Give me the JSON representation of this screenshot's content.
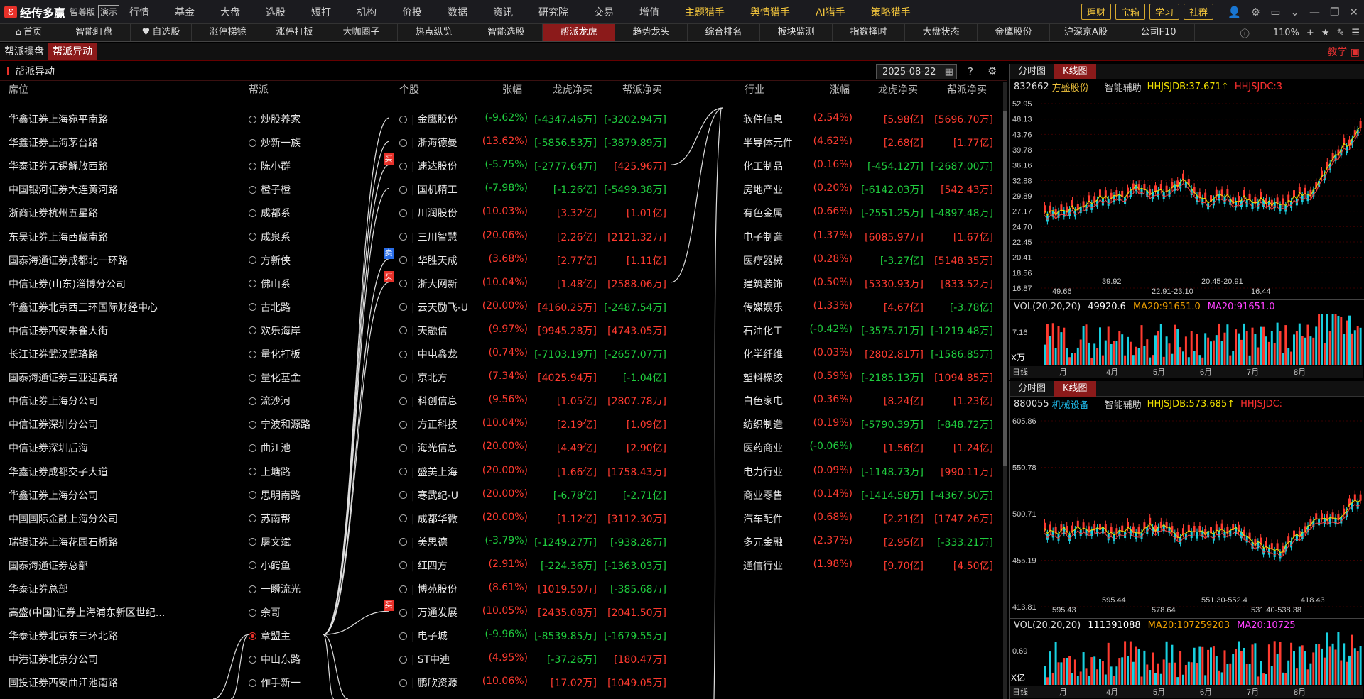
{
  "app": {
    "name": "经传多赢",
    "edition": "智尊版",
    "demo": "演示"
  },
  "menu": [
    "行情",
    "基金",
    "大盘",
    "选股",
    "短打",
    "机构",
    "价投",
    "数据",
    "资讯",
    "研究院",
    "交易",
    "增值"
  ],
  "menu_hl": [
    "主题猎手",
    "舆情猎手",
    "AI猎手",
    "策略猎手"
  ],
  "top_buttons": [
    "理财",
    "宝箱",
    "学习",
    "社群"
  ],
  "tabs": [
    "首页",
    "智能盯盘",
    "自选股",
    "涨停梯镜",
    "涨停打板",
    "大咖圈子",
    "热点纵览",
    "智能选股",
    "帮派龙虎",
    "趋势龙头",
    "综合排名",
    "板块监测",
    "指数择时",
    "大盘状态",
    "金鹰股份",
    "沪深京A股",
    "公司F10"
  ],
  "active_tab": 8,
  "zoom": "110%",
  "subtabs": [
    "帮派操盘",
    "帮派异动"
  ],
  "teach": "教学",
  "panel_title": "帮派异动",
  "date": "2025-08-22",
  "headers": {
    "seat": "席位",
    "gang": "帮派",
    "stock": "个股",
    "pct": "张幅",
    "lh": "龙虎净买",
    "gang_net": "帮派净买",
    "ind": "行业",
    "ind_pct": "涨幅",
    "ind_lh": "龙虎净买",
    "ind_gang": "帮派净买"
  },
  "seats": [
    "华鑫证券上海宛平南路",
    "华鑫证券上海茅台路",
    "华泰证券无锡解放西路",
    "中国银河证券大连黄河路",
    "浙商证券杭州五星路",
    "东吴证券上海西藏南路",
    "国泰海通证券成都北一环路",
    "中信证券(山东)淄博分公司",
    "华鑫证券北京西三环国际财经中心",
    "中信证券西安朱雀大街",
    "长江证券武汉武珞路",
    "国泰海通证券三亚迎宾路",
    "中信证券上海分公司",
    "中信证券深圳分公司",
    "中信证券深圳后海",
    "华鑫证券成都交子大道",
    "华鑫证券上海分公司",
    "中国国际金融上海分公司",
    "瑞银证券上海花园石桥路",
    "国泰海通证券总部",
    "华泰证券总部",
    "高盛(中国)证券上海浦东新区世纪...",
    "华泰证券北京东三环北路",
    "中港证券北京分公司",
    "国投证券西安曲江池南路"
  ],
  "gangs": [
    "炒股养家",
    "炒新一族",
    "陈小群",
    "橙子橙",
    "成都系",
    "成泉系",
    "方新侠",
    "佛山系",
    "古北路",
    "欢乐海岸",
    "量化打板",
    "量化基金",
    "流沙河",
    "宁波和源路",
    "曲江池",
    "上塘路",
    "思明南路",
    "苏南帮",
    "屠文斌",
    "小鳄鱼",
    "一瞬流光",
    "余哥",
    "章盟主",
    "中山东路",
    "作手新一"
  ],
  "active_gang": 22,
  "stocks": [
    {
      "name": "金鹰股份",
      "pct": "(-9.62%)",
      "lh": "[-4347.46万]",
      "gn": "[-3202.94万]",
      "pc": "green",
      "lc": "green",
      "gc": "green"
    },
    {
      "name": "浙海德曼",
      "pct": "(13.62%)",
      "lh": "[-5856.53万]",
      "gn": "[-3879.89万]",
      "pc": "red",
      "lc": "green",
      "gc": "green"
    },
    {
      "name": "速达股份",
      "pct": "(-5.75%)",
      "lh": "[-2777.64万]",
      "gn": "[425.96万]",
      "pc": "green",
      "lc": "green",
      "gc": "red",
      "badge": "买"
    },
    {
      "name": "国机精工",
      "pct": "(-7.98%)",
      "lh": "[-1.26亿]",
      "gn": "[-5499.38万]",
      "pc": "green",
      "lc": "green",
      "gc": "green"
    },
    {
      "name": "川润股份",
      "pct": "(10.03%)",
      "lh": "[3.32亿]",
      "gn": "[1.01亿]",
      "pc": "red",
      "lc": "red",
      "gc": "red"
    },
    {
      "name": "三川智慧",
      "pct": "(20.06%)",
      "lh": "[2.26亿]",
      "gn": "[2121.32万]",
      "pc": "red",
      "lc": "red",
      "gc": "red"
    },
    {
      "name": "华胜天成",
      "pct": "(3.68%)",
      "lh": "[2.77亿]",
      "gn": "[1.11亿]",
      "pc": "red",
      "lc": "red",
      "gc": "red",
      "badge": "卖"
    },
    {
      "name": "浙大网新",
      "pct": "(10.04%)",
      "lh": "[1.48亿]",
      "gn": "[2588.06万]",
      "pc": "red",
      "lc": "red",
      "gc": "red",
      "badge": "买"
    },
    {
      "name": "云天励飞-U",
      "pct": "(20.00%)",
      "lh": "[4160.25万]",
      "gn": "[-2487.54万]",
      "pc": "red",
      "lc": "red",
      "gc": "green"
    },
    {
      "name": "天融信",
      "pct": "(9.97%)",
      "lh": "[9945.28万]",
      "gn": "[4743.05万]",
      "pc": "red",
      "lc": "red",
      "gc": "red"
    },
    {
      "name": "中电鑫龙",
      "pct": "(0.74%)",
      "lh": "[-7103.19万]",
      "gn": "[-2657.07万]",
      "pc": "red",
      "lc": "green",
      "gc": "green"
    },
    {
      "name": "京北方",
      "pct": "(7.34%)",
      "lh": "[4025.94万]",
      "gn": "[-1.04亿]",
      "pc": "red",
      "lc": "red",
      "gc": "green"
    },
    {
      "name": "科创信息",
      "pct": "(9.56%)",
      "lh": "[1.05亿]",
      "gn": "[2807.78万]",
      "pc": "red",
      "lc": "red",
      "gc": "red"
    },
    {
      "name": "方正科技",
      "pct": "(10.04%)",
      "lh": "[2.19亿]",
      "gn": "[1.09亿]",
      "pc": "red",
      "lc": "red",
      "gc": "red"
    },
    {
      "name": "海光信息",
      "pct": "(20.00%)",
      "lh": "[4.49亿]",
      "gn": "[2.90亿]",
      "pc": "red",
      "lc": "red",
      "gc": "red"
    },
    {
      "name": "盛美上海",
      "pct": "(20.00%)",
      "lh": "[1.66亿]",
      "gn": "[1758.43万]",
      "pc": "red",
      "lc": "red",
      "gc": "red"
    },
    {
      "name": "寒武纪-U",
      "pct": "(20.00%)",
      "lh": "[-6.78亿]",
      "gn": "[-2.71亿]",
      "pc": "red",
      "lc": "green",
      "gc": "green"
    },
    {
      "name": "成都华微",
      "pct": "(20.00%)",
      "lh": "[1.12亿]",
      "gn": "[3112.30万]",
      "pc": "red",
      "lc": "red",
      "gc": "red"
    },
    {
      "name": "美思德",
      "pct": "(-3.79%)",
      "lh": "[-1249.27万]",
      "gn": "[-938.28万]",
      "pc": "green",
      "lc": "green",
      "gc": "green"
    },
    {
      "name": "红四方",
      "pct": "(2.91%)",
      "lh": "[-224.36万]",
      "gn": "[-1363.03万]",
      "pc": "red",
      "lc": "green",
      "gc": "green"
    },
    {
      "name": "博苑股份",
      "pct": "(8.61%)",
      "lh": "[1019.50万]",
      "gn": "[-385.68万]",
      "pc": "red",
      "lc": "red",
      "gc": "green"
    },
    {
      "name": "万通发展",
      "pct": "(10.05%)",
      "lh": "[2435.08万]",
      "gn": "[2041.50万]",
      "pc": "red",
      "lc": "red",
      "gc": "red",
      "badge": "买"
    },
    {
      "name": "电子城",
      "pct": "(-9.96%)",
      "lh": "[-8539.85万]",
      "gn": "[-1679.55万]",
      "pc": "green",
      "lc": "green",
      "gc": "green"
    },
    {
      "name": "ST中迪",
      "pct": "(4.95%)",
      "lh": "[-37.26万]",
      "gn": "[180.47万]",
      "pc": "red",
      "lc": "green",
      "gc": "red"
    },
    {
      "name": "鹏欣资源",
      "pct": "(10.06%)",
      "lh": "[17.02万]",
      "gn": "[1049.05万]",
      "pc": "red",
      "lc": "red",
      "gc": "red"
    }
  ],
  "industries": [
    {
      "name": "软件信息",
      "pct": "(2.54%)",
      "lh": "[5.98亿]",
      "gn": "[5696.70万]",
      "pc": "red",
      "lc": "red",
      "gc": "red"
    },
    {
      "name": "半导体元件",
      "pct": "(4.62%)",
      "lh": "[2.68亿]",
      "gn": "[1.77亿]",
      "pc": "red",
      "lc": "red",
      "gc": "red"
    },
    {
      "name": "化工制品",
      "pct": "(0.16%)",
      "lh": "[-454.12万]",
      "gn": "[-2687.00万]",
      "pc": "red",
      "lc": "green",
      "gc": "green"
    },
    {
      "name": "房地产业",
      "pct": "(0.20%)",
      "lh": "[-6142.03万]",
      "gn": "[542.43万]",
      "pc": "red",
      "lc": "green",
      "gc": "red"
    },
    {
      "name": "有色金属",
      "pct": "(0.66%)",
      "lh": "[-2551.25万]",
      "gn": "[-4897.48万]",
      "pc": "red",
      "lc": "green",
      "gc": "green"
    },
    {
      "name": "电子制造",
      "pct": "(1.37%)",
      "lh": "[6085.97万]",
      "gn": "[1.67亿]",
      "pc": "red",
      "lc": "red",
      "gc": "red"
    },
    {
      "name": "医疗器械",
      "pct": "(0.28%)",
      "lh": "[-3.27亿]",
      "gn": "[5148.35万]",
      "pc": "red",
      "lc": "green",
      "gc": "red"
    },
    {
      "name": "建筑装饰",
      "pct": "(0.50%)",
      "lh": "[5330.93万]",
      "gn": "[833.52万]",
      "pc": "red",
      "lc": "red",
      "gc": "red"
    },
    {
      "name": "传媒娱乐",
      "pct": "(1.33%)",
      "lh": "[4.67亿]",
      "gn": "[-3.78亿]",
      "pc": "red",
      "lc": "red",
      "gc": "green"
    },
    {
      "name": "石油化工",
      "pct": "(-0.42%)",
      "lh": "[-3575.71万]",
      "gn": "[-1219.48万]",
      "pc": "green",
      "lc": "green",
      "gc": "green"
    },
    {
      "name": "化学纤维",
      "pct": "(0.03%)",
      "lh": "[2802.81万]",
      "gn": "[-1586.85万]",
      "pc": "red",
      "lc": "red",
      "gc": "green"
    },
    {
      "name": "塑料橡胶",
      "pct": "(0.59%)",
      "lh": "[-2185.13万]",
      "gn": "[1094.85万]",
      "pc": "red",
      "lc": "green",
      "gc": "red"
    },
    {
      "name": "白色家电",
      "pct": "(0.36%)",
      "lh": "[8.24亿]",
      "gn": "[1.23亿]",
      "pc": "red",
      "lc": "red",
      "gc": "red"
    },
    {
      "name": "纺织制造",
      "pct": "(0.19%)",
      "lh": "[-5790.39万]",
      "gn": "[-848.72万]",
      "pc": "red",
      "lc": "green",
      "gc": "green"
    },
    {
      "name": "医药商业",
      "pct": "(-0.06%)",
      "lh": "[1.56亿]",
      "gn": "[1.24亿]",
      "pc": "green",
      "lc": "red",
      "gc": "red"
    },
    {
      "name": "电力行业",
      "pct": "(0.09%)",
      "lh": "[-1148.73万]",
      "gn": "[990.11万]",
      "pc": "red",
      "lc": "green",
      "gc": "red"
    },
    {
      "name": "商业零售",
      "pct": "(0.14%)",
      "lh": "[-1414.58万]",
      "gn": "[-4367.50万]",
      "pc": "red",
      "lc": "green",
      "gc": "green"
    },
    {
      "name": "汽车配件",
      "pct": "(0.68%)",
      "lh": "[2.21亿]",
      "gn": "[1747.26万]",
      "pc": "red",
      "lc": "red",
      "gc": "red"
    },
    {
      "name": "多元金融",
      "pct": "(2.37%)",
      "lh": "[2.95亿]",
      "gn": "[-333.21万]",
      "pc": "red",
      "lc": "red",
      "gc": "green"
    },
    {
      "name": "通信行业",
      "pct": "(1.98%)",
      "lh": "[9.70亿]",
      "gn": "[4.50亿]",
      "pc": "red",
      "lc": "red",
      "gc": "red"
    }
  ],
  "chart1": {
    "tabs": [
      "分时图",
      "K线图"
    ],
    "code": "832662",
    "name": "方盛股份",
    "assist": "智能辅助",
    "ind1": "HHJSJDB:37.671↑",
    "ind2": "HHJSJDC:3",
    "yticks": [
      "52.95",
      "48.13",
      "43.76",
      "39.78",
      "36.16",
      "32.88",
      "29.89",
      "27.17",
      "24.70",
      "22.45",
      "20.41",
      "18.56",
      "16.87"
    ],
    "marks": [
      "49.66",
      "39.92",
      "22.91-23.10",
      "20.45-20.91",
      "16.44"
    ],
    "vol": "VOL(20,20,20)",
    "vol_val": "49920.6",
    "vol_ma": "MA20:91651.0",
    "vol_ma2": "MA20:91651.0",
    "vol_tick": "7.16",
    "vol_unit": "X万",
    "months": [
      "日线",
      "月",
      "4月",
      "5月",
      "6月",
      "7月",
      "8月"
    ]
  },
  "chart2": {
    "tabs": [
      "分时图",
      "K线图"
    ],
    "code": "880055",
    "name": "机械设备",
    "assist": "智能辅助",
    "ind1": "HHJSJDB:573.685↑",
    "ind2": "HHJSJDC:",
    "yticks": [
      "605.86",
      "550.78",
      "500.71",
      "455.19",
      "413.81"
    ],
    "marks": [
      "595.43",
      "595.44",
      "578.64",
      "551.30-552.4",
      "531.40-538.38",
      "418.43"
    ],
    "vol": "VOL(20,20,20)",
    "vol_val": "111391088",
    "vol_ma": "MA20:107259203",
    "vol_ma2": "MA20:10725",
    "vol_tick": "0.69",
    "vol_unit": "X亿",
    "months": [
      "日线",
      "月",
      "4月",
      "5月",
      "6月",
      "7月",
      "8月"
    ]
  },
  "colors": {
    "accent": "#8b1a1a",
    "up": "#ff3b30",
    "down": "#1fcc3e",
    "gold": "#f0c33c"
  }
}
